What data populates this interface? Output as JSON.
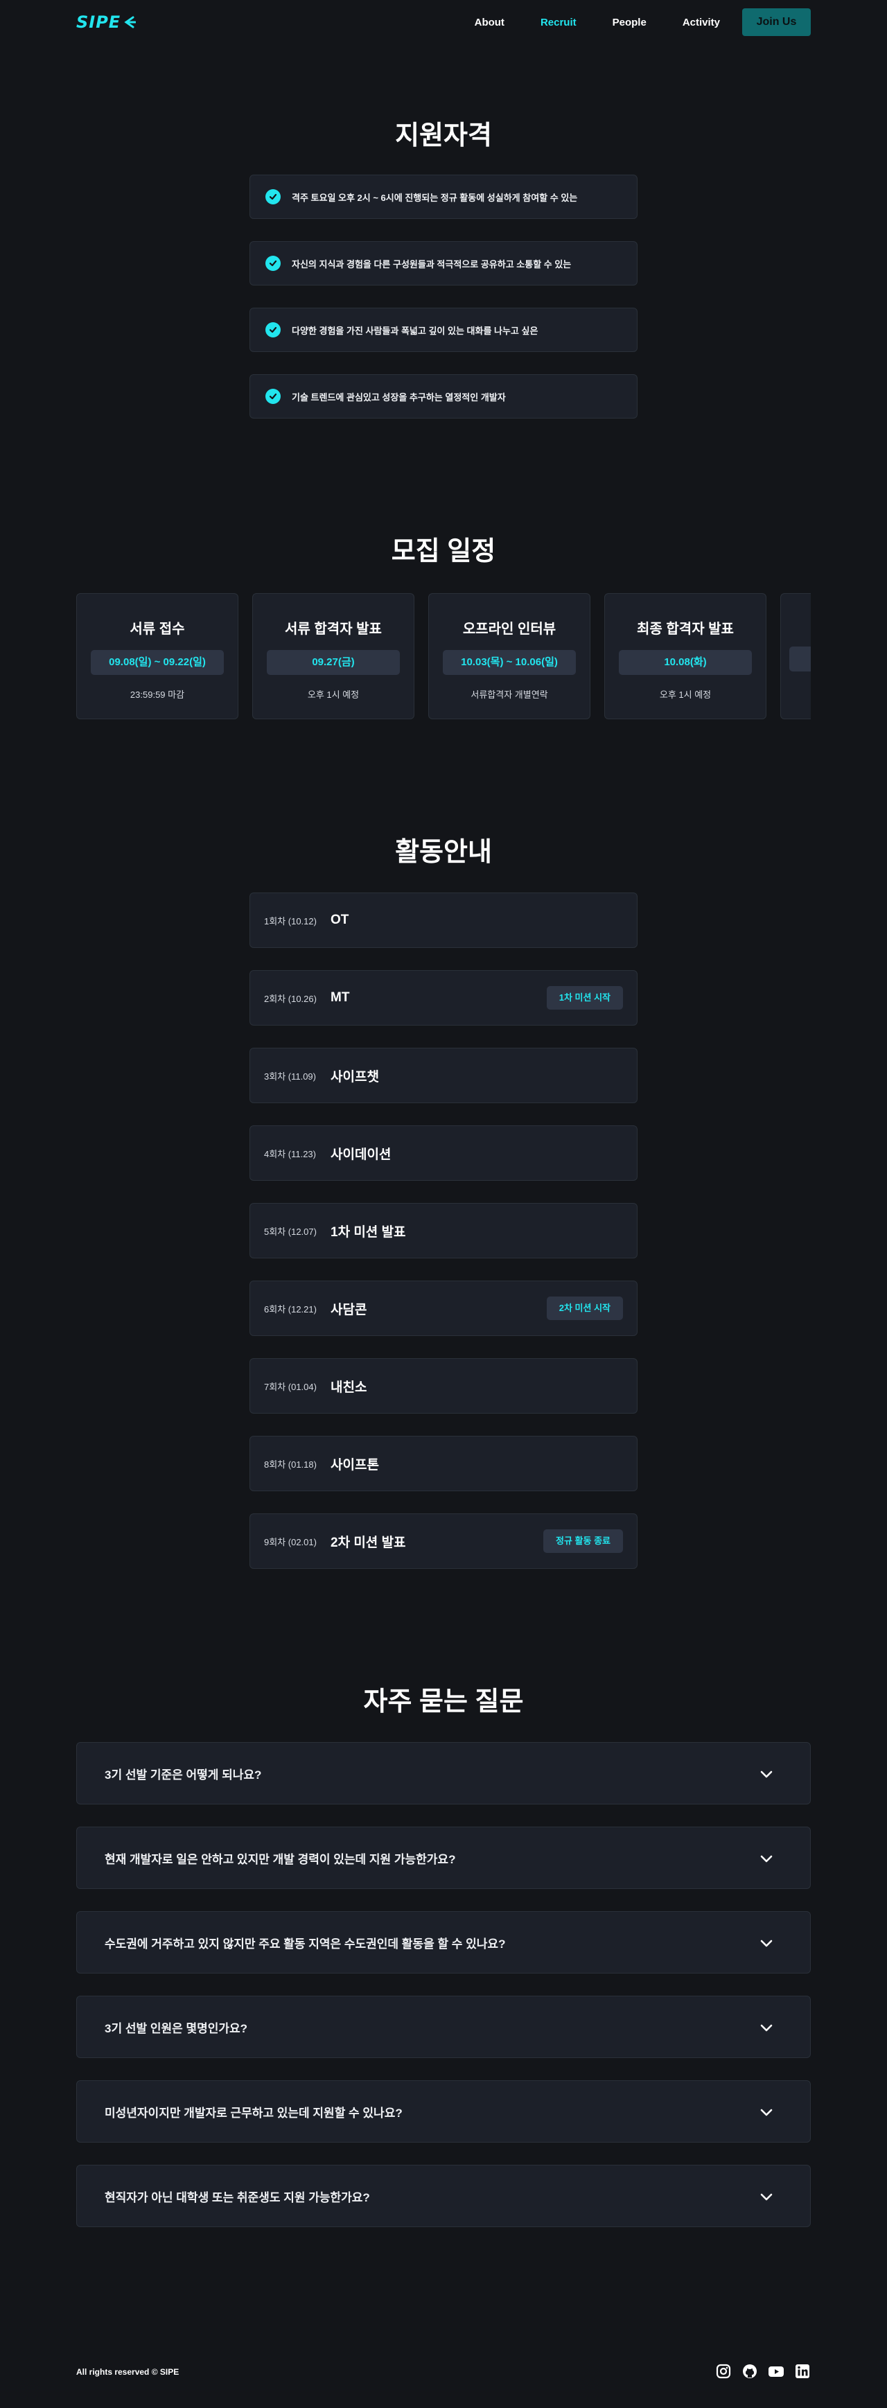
{
  "header": {
    "logo": "SIPE",
    "nav": [
      "About",
      "Recruit",
      "People",
      "Activity"
    ],
    "join_label": "Join Us"
  },
  "colors": {
    "accent": "#22e5ee",
    "background": "#131519",
    "card": "#1c2029",
    "join_button": "#0f6a6e"
  },
  "qualifications": {
    "title": "지원자격",
    "items": [
      "격주 토요일 오후 2시 ~ 6시에 진행되는 정규 활동에 성실하게 참여할 수 있는",
      "자신의 지식과 경험을 다른 구성원들과 적극적으로 공유하고 소통할 수 있는",
      "다양한 경험을 가진 사람들과 폭넓고 깊이 있는 대화를 나누고 싶은",
      "기술 트렌드에 관심있고 성장을 추구하는 열정적인 개발자"
    ]
  },
  "schedule": {
    "title": "모집 일정",
    "cards": [
      {
        "title": "서류 접수",
        "date": "09.08(일) ~ 09.22(일)",
        "note": "23:59:59 마감"
      },
      {
        "title": "서류 합격자 발표",
        "date": "09.27(금)",
        "note": "오후 1시 예정"
      },
      {
        "title": "오프라인 인터뷰",
        "date": "10.03(목) ~ 10.06(일)",
        "note": "서류합격자 개별연락"
      },
      {
        "title": "최종 합격자 발표",
        "date": "10.08(화)",
        "note": "오후 1시 예정"
      }
    ]
  },
  "activities": {
    "title": "활동안내",
    "items": [
      {
        "round": "1회차 (10.12)",
        "name": "OT",
        "badge": ""
      },
      {
        "round": "2회차 (10.26)",
        "name": "MT",
        "badge": "1차 미션 시작"
      },
      {
        "round": "3회차 (11.09)",
        "name": "사이프챗",
        "badge": ""
      },
      {
        "round": "4회차 (11.23)",
        "name": "사이데이션",
        "badge": ""
      },
      {
        "round": "5회차 (12.07)",
        "name": "1차 미션 발표",
        "badge": ""
      },
      {
        "round": "6회차 (12.21)",
        "name": "사담콘",
        "badge": "2차 미션 시작"
      },
      {
        "round": "7회차 (01.04)",
        "name": "내친소",
        "badge": ""
      },
      {
        "round": "8회차 (01.18)",
        "name": "사이프톤",
        "badge": ""
      },
      {
        "round": "9회차 (02.01)",
        "name": "2차 미션 발표",
        "badge": "정규 활동 종료"
      }
    ]
  },
  "faq": {
    "title": "자주 묻는 질문",
    "items": [
      "3기 선발 기준은 어떻게 되나요?",
      "현재 개발자로 일은 안하고 있지만 개발 경력이 있는데 지원 가능한가요?",
      "수도권에 거주하고 있지 않지만 주요 활동 지역은 수도권인데 활동을 할 수 있나요?",
      "3기 선발 인원은 몇명인가요?",
      "미성년자이지만 개발자로 근무하고 있는데 지원할 수 있나요?",
      "현직자가 아닌 대학생 또는 취준생도 지원 가능한가요?"
    ]
  },
  "footer": {
    "copyright": "All rights reserved © SIPE",
    "social_icons": [
      "instagram-icon",
      "github-icon",
      "youtube-icon",
      "linkedin-icon"
    ]
  }
}
